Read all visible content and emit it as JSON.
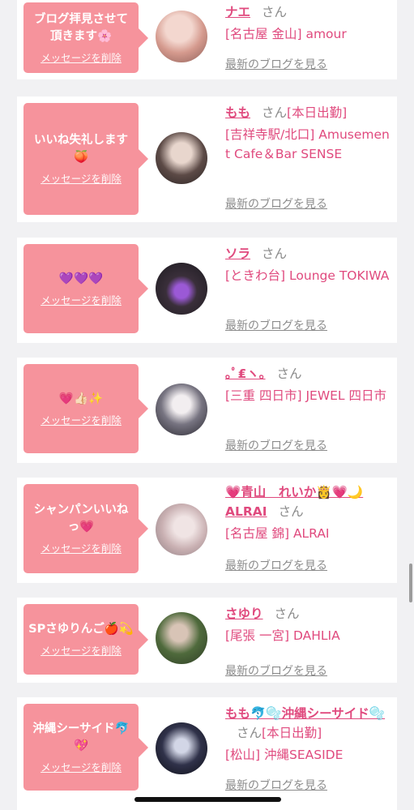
{
  "delete_label": "メッセージを削除",
  "blog_label": "最新のブログを見る",
  "san_label": "さん",
  "colors": {
    "bubble": "#f6939c",
    "name": "#e04a7e",
    "muted": "#8c8c8c",
    "background": "#f1f1f3"
  },
  "items": [
    {
      "message": "ブログ拝見させて頂きます🌸",
      "name": "ナエ",
      "name_extra": "",
      "shop": "[名古屋 金山] amour"
    },
    {
      "message": "いいね失礼します🍑",
      "name": "もも",
      "name_extra": "[本日出勤]",
      "shop": "[吉祥寺駅/北口] Amusement Cafe＆Bar SENSE"
    },
    {
      "message": "💜💜💜",
      "name": "ソラ",
      "name_extra": "",
      "shop": "[ときわ台] Lounge TOKIWA"
    },
    {
      "message": "💗👍🏻✨",
      "name": "｡ﾟ₤ヽ｡",
      "name_extra": "",
      "shop": "[三重 四日市] JEWEL 四日市"
    },
    {
      "message": "シャンパンいいねっ💗",
      "name": "💗青山　れいか👸💗🌙 ALRAI",
      "name_extra": "",
      "shop": "[名古屋 錦] ALRAI"
    },
    {
      "message": "SPさゆりんご🍎💫",
      "name": "さゆり",
      "name_extra": "",
      "shop": "[尾張 一宮] DAHLIA"
    },
    {
      "message": "沖縄シーサイド🐬💖",
      "name": "もも🐬🫧沖縄シーサイド🫧",
      "name_extra": "[本日出勤]",
      "shop": "[松山] 沖縄SEASIDE"
    }
  ]
}
